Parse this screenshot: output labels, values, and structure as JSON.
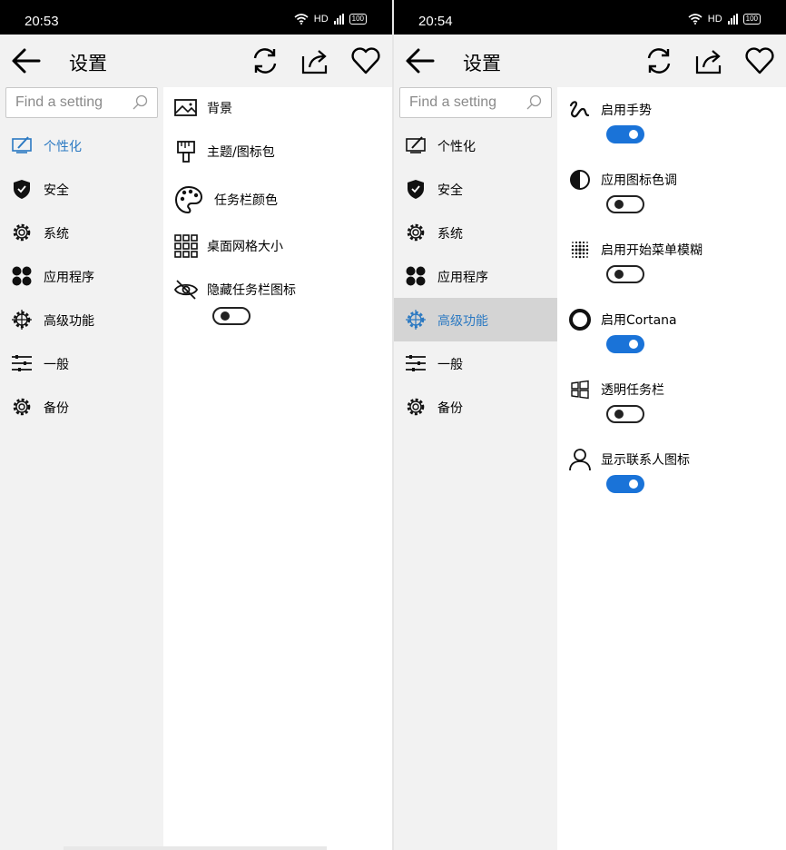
{
  "left": {
    "status": {
      "time": "20:53",
      "net": "HD",
      "battery": "100"
    },
    "appbar": {
      "title": "设置"
    },
    "search": {
      "placeholder": "Find a setting"
    },
    "nav": [
      {
        "label": "个性化",
        "icon": "personalize-icon"
      },
      {
        "label": "安全",
        "icon": "shield-icon"
      },
      {
        "label": "系统",
        "icon": "gear-icon"
      },
      {
        "label": "应用程序",
        "icon": "apps-icon"
      },
      {
        "label": "高级功能",
        "icon": "advanced-gear-icon"
      },
      {
        "label": "一般",
        "icon": "sliders-icon"
      },
      {
        "label": "备份",
        "icon": "backup-gear-icon"
      }
    ],
    "items": [
      {
        "label": "背景",
        "icon": "image-icon"
      },
      {
        "label": "主题/图标包",
        "icon": "brush-icon"
      },
      {
        "label": "任务栏颜色",
        "icon": "palette-icon"
      },
      {
        "label": "桌面网格大小",
        "icon": "grid-icon"
      },
      {
        "label": "隐藏任务栏图标",
        "icon": "eye-off-icon",
        "toggle": false
      }
    ]
  },
  "right": {
    "status": {
      "time": "20:54",
      "net": "HD",
      "battery": "100"
    },
    "appbar": {
      "title": "设置"
    },
    "search": {
      "placeholder": "Find a setting"
    },
    "nav": [
      {
        "label": "个性化"
      },
      {
        "label": "安全"
      },
      {
        "label": "系统"
      },
      {
        "label": "应用程序"
      },
      {
        "label": "高级功能",
        "selected": true
      },
      {
        "label": "一般"
      },
      {
        "label": "备份"
      }
    ],
    "items": [
      {
        "label": "启用手势",
        "icon": "gesture-icon",
        "toggle": true
      },
      {
        "label": "应用图标色调",
        "icon": "contrast-icon",
        "toggle": false
      },
      {
        "label": "启用开始菜单模糊",
        "icon": "blur-icon",
        "toggle": false
      },
      {
        "label": "启用Cortana",
        "icon": "cortana-icon",
        "toggle": true
      },
      {
        "label": "透明任务栏",
        "icon": "windows-icon",
        "toggle": false
      },
      {
        "label": "显示联系人图标",
        "icon": "person-icon",
        "toggle": true
      }
    ]
  },
  "colors": {
    "accent": "#2b79c2",
    "toggle_on": "#1a73d8",
    "sidebar_bg": "#f2f2f2",
    "selected_bg": "#d4d4d4"
  }
}
